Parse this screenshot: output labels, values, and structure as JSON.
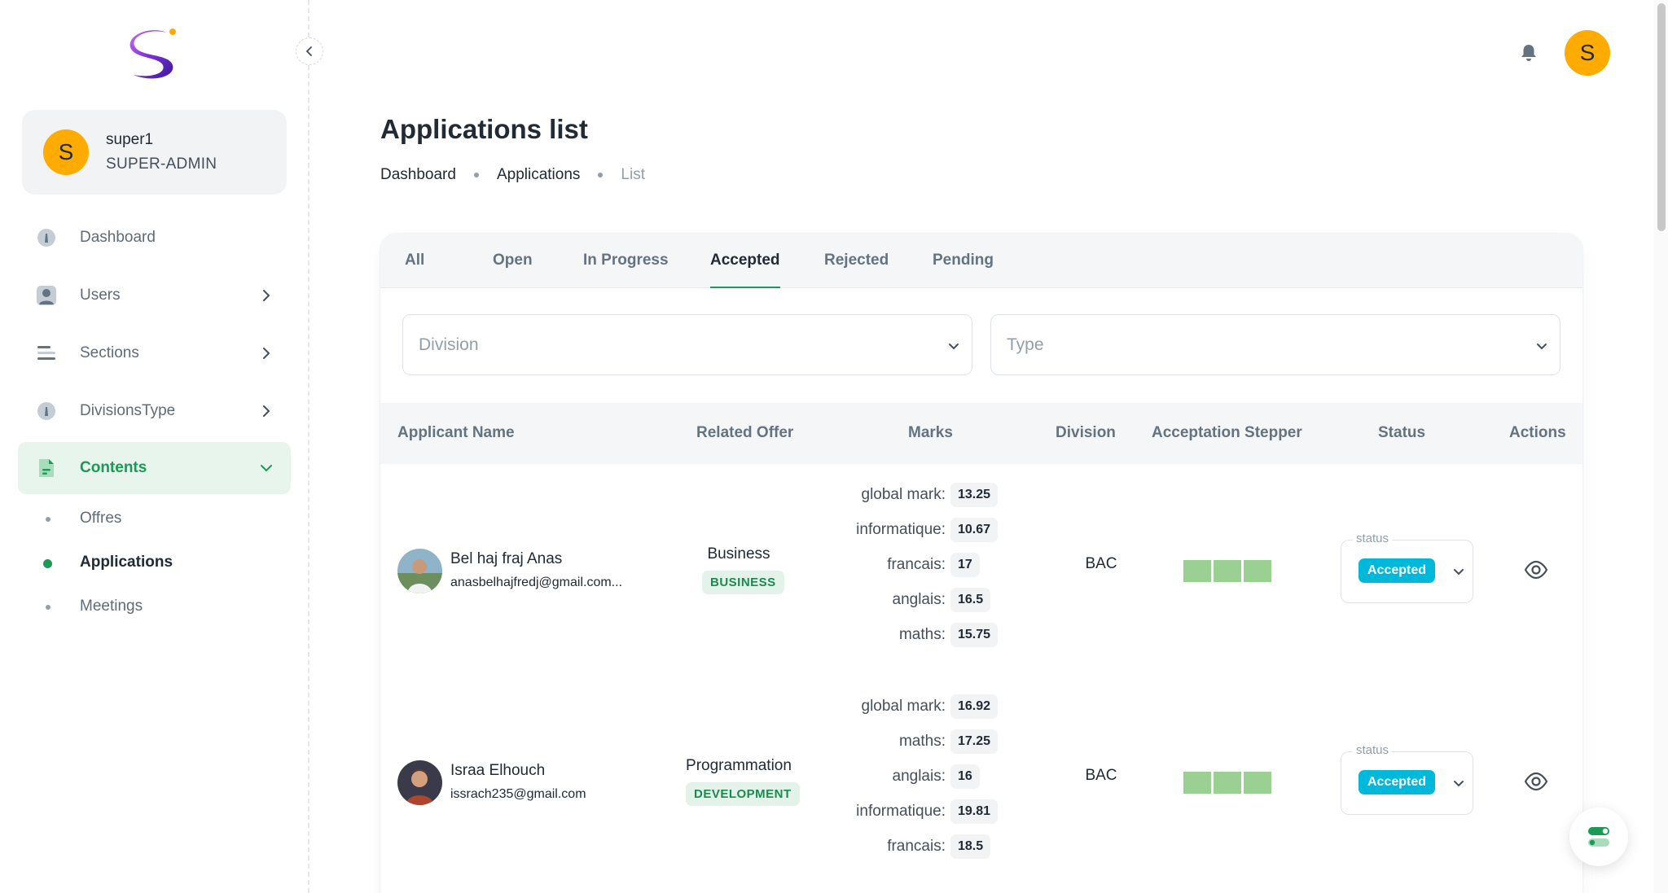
{
  "brand": {
    "logo_icon": "swirl-s-logo",
    "accent": "#1a9a55"
  },
  "user": {
    "initial": "S",
    "name": "super1",
    "role": "SUPER-ADMIN",
    "avatar_color": "#ffab00"
  },
  "sidebar": {
    "items": [
      {
        "label": "Dashboard",
        "icon": "dashboard-icon",
        "has_chevron": false
      },
      {
        "label": "Users",
        "icon": "user-icon",
        "has_chevron": true
      },
      {
        "label": "Sections",
        "icon": "sections-icon",
        "has_chevron": true
      },
      {
        "label": "DivisionsType",
        "icon": "dashboard-icon",
        "has_chevron": true
      },
      {
        "label": "Contents",
        "icon": "file-icon",
        "has_chevron": true,
        "active": true
      }
    ],
    "sub_items": [
      {
        "label": "Offres",
        "active": false
      },
      {
        "label": "Applications",
        "active": true
      },
      {
        "label": "Meetings",
        "active": false
      }
    ]
  },
  "header": {
    "avatar_initial": "S"
  },
  "page": {
    "title": "Applications list",
    "breadcrumb": [
      "Dashboard",
      "Applications",
      "List"
    ]
  },
  "tabs": [
    "All",
    "Open",
    "In Progress",
    "Accepted",
    "Rejected",
    "Pending"
  ],
  "active_tab": "Accepted",
  "filters": {
    "division_placeholder": "Division",
    "type_placeholder": "Type"
  },
  "table": {
    "headers": [
      "Applicant Name",
      "Related Offer",
      "Marks",
      "Division",
      "Acceptation Stepper",
      "Status",
      "Actions"
    ],
    "rows": [
      {
        "name": "Bel haj fraj Anas",
        "email": "anasbelhajfredj@gmail.com...",
        "offer": "Business",
        "offer_tag": "BUSINESS",
        "marks": [
          {
            "label": "global mark:",
            "value": "13.25"
          },
          {
            "label": "informatique:",
            "value": "10.67"
          },
          {
            "label": "francais:",
            "value": "17"
          },
          {
            "label": "anglais:",
            "value": "16.5"
          },
          {
            "label": "maths:",
            "value": "15.75"
          }
        ],
        "division": "BAC",
        "stepper_steps_completed": 3,
        "status_label": "status",
        "status": "Accepted"
      },
      {
        "name": "Israa Elhouch",
        "email": "issrach235@gmail.com",
        "offer": "Programmation",
        "offer_tag": "DEVELOPMENT",
        "marks": [
          {
            "label": "global mark:",
            "value": "16.92"
          },
          {
            "label": "maths:",
            "value": "17.25"
          },
          {
            "label": "anglais:",
            "value": "16"
          },
          {
            "label": "informatique:",
            "value": "19.81"
          },
          {
            "label": "francais:",
            "value": "18.5"
          }
        ],
        "division": "BAC",
        "stepper_steps_completed": 3,
        "status_label": "status",
        "status": "Accepted"
      }
    ]
  }
}
